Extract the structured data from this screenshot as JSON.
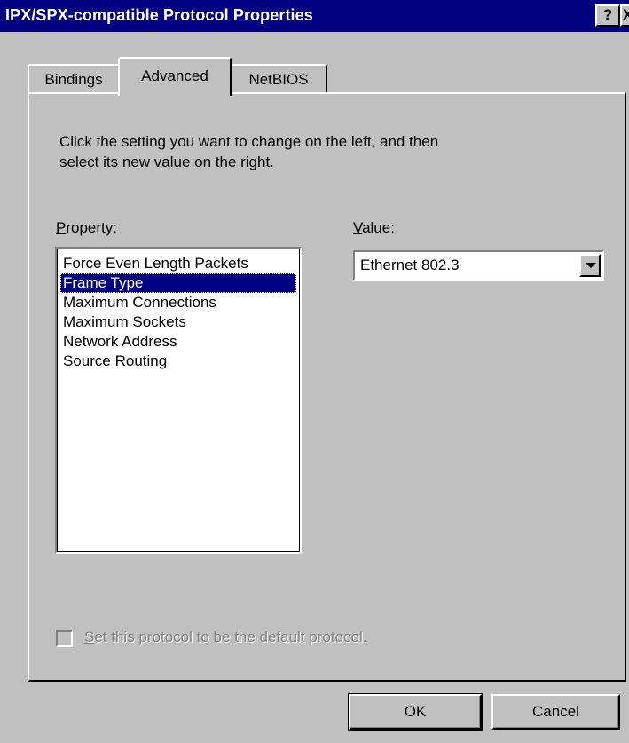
{
  "window": {
    "title": "IPX/SPX-compatible Protocol Properties",
    "help_glyph": "?",
    "close_glyph": "X"
  },
  "tabs": [
    {
      "label": "Bindings",
      "active": false
    },
    {
      "label": "Advanced",
      "active": true
    },
    {
      "label": "NetBIOS",
      "active": false
    }
  ],
  "advanced": {
    "instructions": "Click the setting you want to change on the left, and then\nselect its new value on the right.",
    "property_label_mnemonic": "P",
    "property_label_rest": "roperty:",
    "value_label_mnemonic": "V",
    "value_label_rest": "alue:",
    "properties": [
      "Force Even Length Packets",
      "Frame Type",
      "Maximum Connections",
      "Maximum Sockets",
      "Network Address",
      "Source Routing"
    ],
    "selected_property": "Frame Type",
    "value": "Ethernet 802.3",
    "default_checkbox_mnemonic": "S",
    "default_checkbox_rest": "et this protocol to be the default protocol.",
    "default_checkbox_checked": false,
    "default_checkbox_enabled": false
  },
  "buttons": {
    "ok": "OK",
    "cancel": "Cancel"
  },
  "colors": {
    "face": "#c0c0c0",
    "title_bar": "#000080",
    "selection": "#000080",
    "disabled_text": "#808080"
  }
}
